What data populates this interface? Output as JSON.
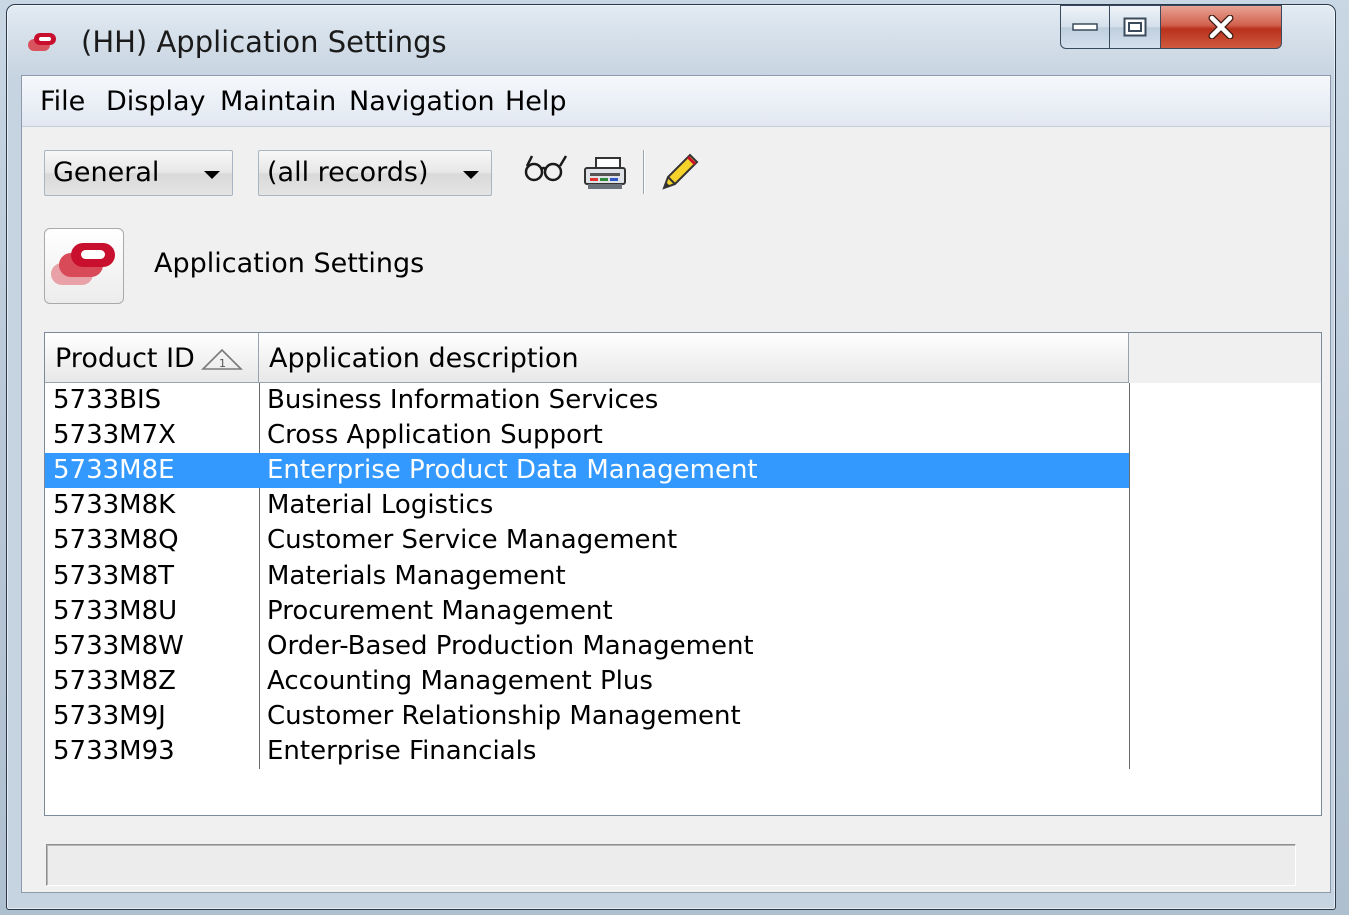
{
  "window": {
    "title": "(HH) Application Settings",
    "controls": {
      "minimize_icon": "minimize-icon",
      "maximize_icon": "maximize-icon",
      "close_icon": "close-icon"
    }
  },
  "menu": [
    "File",
    "Display",
    "Maintain",
    "Navigation",
    "Help"
  ],
  "toolbar": {
    "view_select": {
      "value": "General"
    },
    "record_filter": {
      "value": "(all records)"
    },
    "tools": [
      "glasses-icon",
      "printer-icon",
      "pencil-icon"
    ]
  },
  "header": {
    "app_icon": "app-settings-icon",
    "title": "Application Settings"
  },
  "list": {
    "columns": [
      "Product ID",
      "Application description"
    ],
    "sort_indicator": "1",
    "selected_index": 2,
    "rows": [
      {
        "id": "5733BIS",
        "description": "Business Information Services"
      },
      {
        "id": "5733M7X",
        "description": "Cross Application Support"
      },
      {
        "id": "5733M8E",
        "description": "Enterprise Product Data Management"
      },
      {
        "id": "5733M8K",
        "description": "Material Logistics"
      },
      {
        "id": "5733M8Q",
        "description": "Customer Service Management"
      },
      {
        "id": "5733M8T",
        "description": "Materials Management"
      },
      {
        "id": "5733M8U",
        "description": "Procurement Management"
      },
      {
        "id": "5733M8W",
        "description": "Order-Based Production Management"
      },
      {
        "id": "5733M8Z",
        "description": "Accounting Management Plus"
      },
      {
        "id": "5733M9J",
        "description": "Customer Relationship Management"
      },
      {
        "id": "5733M93",
        "description": "Enterprise Financials"
      }
    ]
  },
  "status": {
    "text": ""
  },
  "colors": {
    "selection": "#3399ff",
    "brand": "#c8102e"
  }
}
